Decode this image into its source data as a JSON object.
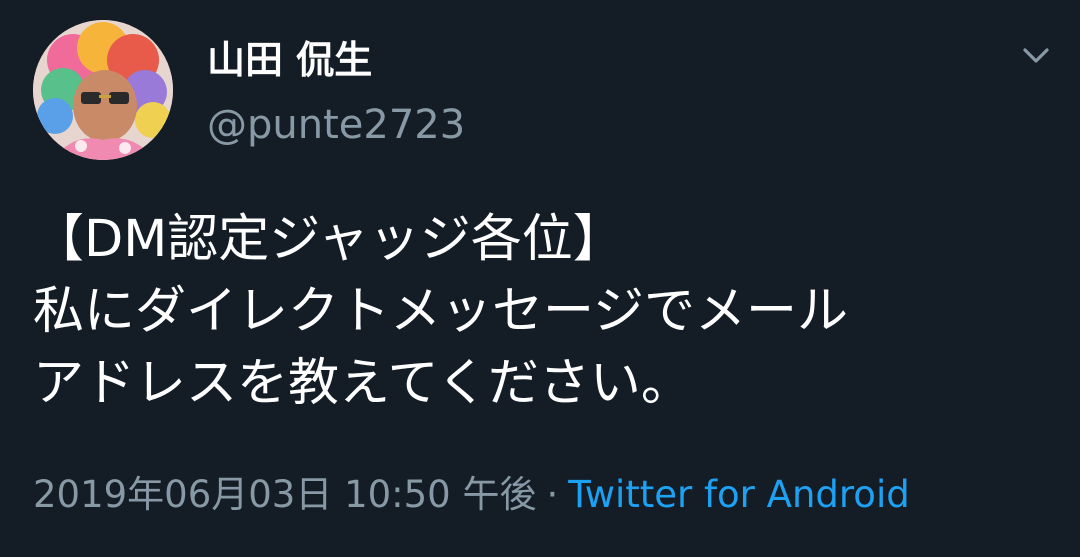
{
  "tweet": {
    "display_name": "山田 侃生",
    "handle": "@punte2723",
    "text_lines": [
      "【DM認定ジャッジ各位】",
      "私にダイレクトメッセージでメール",
      "アドレスを教えてください。"
    ],
    "timestamp": "2019年06月03日 10:50 午後",
    "separator": "·",
    "source": "Twitter for Android"
  },
  "icons": {
    "menu": "chevron-down-icon",
    "avatar": "profile-avatar"
  },
  "colors": {
    "background": "#141d26",
    "primary_text": "#ffffff",
    "secondary_text": "#8899a6",
    "link": "#1da1f2"
  }
}
